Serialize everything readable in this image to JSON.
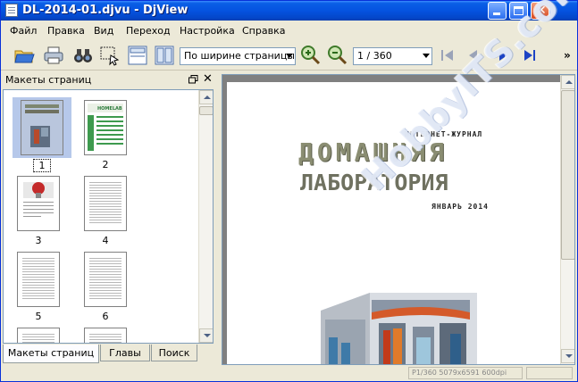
{
  "window": {
    "title": "DL-2014-01.djvu - DjView"
  },
  "menu": {
    "items": [
      "Файл",
      "Правка",
      "Вид",
      "Переход",
      "Настройка",
      "Справка"
    ]
  },
  "toolbar": {
    "zoom_value": "По ширине страницы",
    "page_value": "1 / 360",
    "overflow": "»"
  },
  "panel": {
    "title": "Макеты страниц",
    "thumbnails": [
      {
        "label": "1",
        "selected": true
      },
      {
        "label": "2"
      },
      {
        "label": "3"
      },
      {
        "label": "4"
      },
      {
        "label": "5"
      },
      {
        "label": "6"
      }
    ],
    "tabs": [
      "Макеты страниц",
      "Главы",
      "Поиск"
    ]
  },
  "document": {
    "top_line": "ИНТЕРНЕТ-ЖУРНАЛ",
    "title_line1": "ДОМАШНЯЯ",
    "title_line2": "ЛАБОРАТОРИЯ",
    "date_line": "ЯНВАРЬ 2014",
    "thumb2_header": "HOMELAB"
  },
  "watermark": "HobbyITS.com",
  "status": {
    "text": "P1/360 5079x6591 600dpi"
  },
  "colors": {
    "titlebar": "#0553e0",
    "selection": "#b6c8ea",
    "doc_background": "#808080"
  }
}
